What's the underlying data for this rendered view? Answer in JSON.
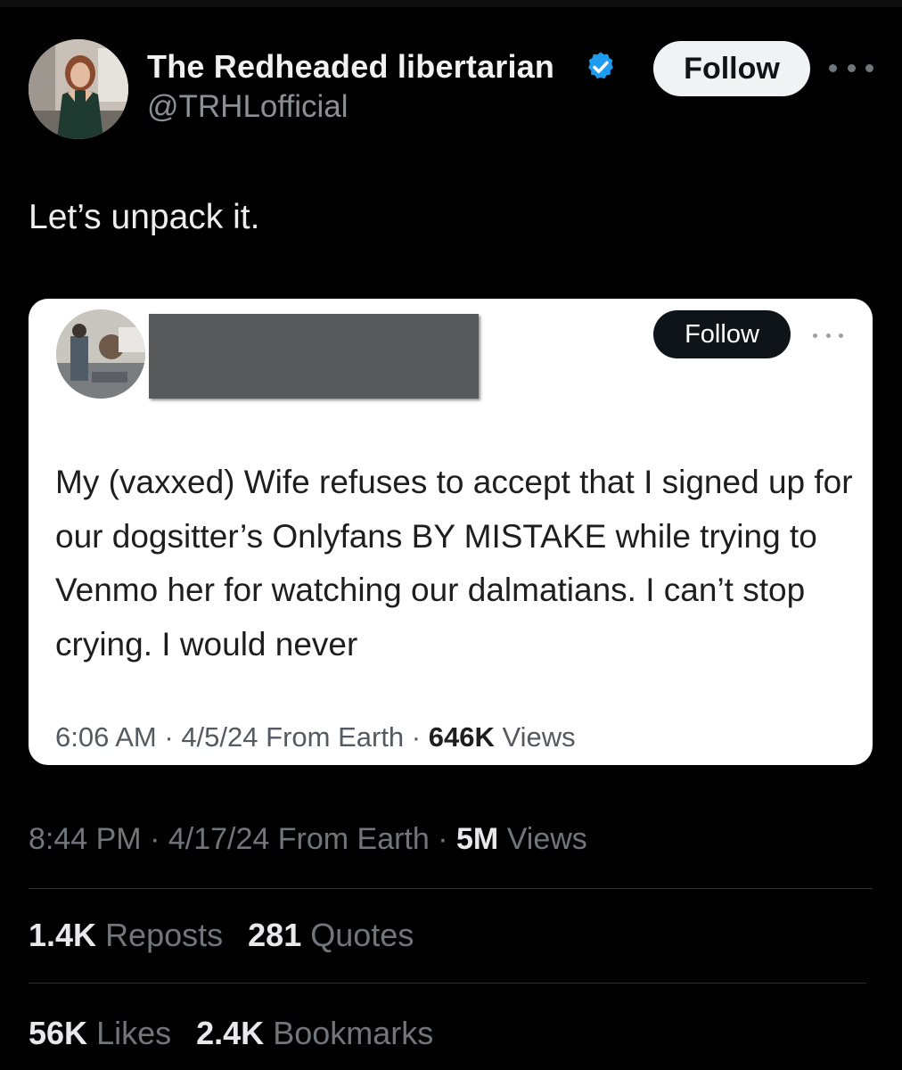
{
  "author": {
    "display_name": "The Redheaded libertarian",
    "handle": "@TRHLofficial",
    "verified_icon": "verified-badge-icon",
    "follow_label": "Follow"
  },
  "tweet": {
    "text": "Let’s unpack it.",
    "time": "8:44 PM",
    "date": "4/17/24",
    "source": "From Earth",
    "views_count": "5M",
    "views_label": "Views"
  },
  "embedded_post": {
    "follow_label": "Follow",
    "text": "My (vaxxed) Wife refuses to accept that I signed up for our dogsitter’s Onlyfans BY MISTAKE while trying to Venmo her for watching our dalmatians. I can’t stop crying. I would never",
    "time": "6:06 AM",
    "date": "4/5/24",
    "source": "From Earth",
    "views_count": "646K",
    "views_label": "Views"
  },
  "stats": {
    "reposts": {
      "count": "1.4K",
      "label": "Reposts"
    },
    "quotes": {
      "count": "281",
      "label": "Quotes"
    },
    "likes": {
      "count": "56K",
      "label": "Likes"
    },
    "bookmarks": {
      "count": "2.4K",
      "label": "Bookmarks"
    }
  },
  "colors": {
    "background": "#000000",
    "verified_blue": "#1d9bf0",
    "muted_text": "#71767b",
    "follow_button_bg": "#eff3f4"
  }
}
